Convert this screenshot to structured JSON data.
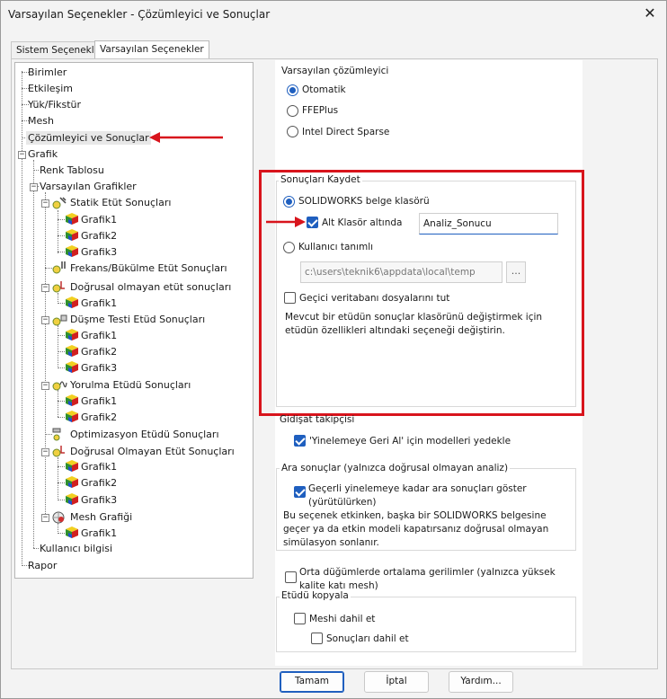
{
  "window": {
    "title": "Varsayılan Seçenekler - Çözümleyici ve Sonuçlar",
    "close_glyph": "✕"
  },
  "tabs": [
    {
      "label": "Sistem Seçenekleri"
    },
    {
      "label": "Varsayılan Seçenekler"
    }
  ],
  "tree": {
    "birimler": "Birimler",
    "etkilesim": "Etkileşim",
    "yuk": "Yük/Fikstür",
    "mesh": "Mesh",
    "cozumleyici": "Çözümleyici ve Sonuçlar",
    "grafik": "Grafik",
    "renk": "Renk Tablosu",
    "varsayilan_grafikler": "Varsayılan Grafikler",
    "statik": "Statik Etüt Sonuçları",
    "frekans": "Frekans/Bükülme Etüt Sonuçları",
    "dogrusal_olmayan": "Doğrusal olmayan etüt sonuçları",
    "dusme": "Düşme Testi Etüd Sonuçları",
    "yorulma": "Yorulma Etüdü Sonuçları",
    "optimizasyon": "Optimizasyon Etüdü Sonuçları",
    "dogrusal_olmayan2": "Doğrusal Olmayan Etüt Sonuçları",
    "mesh_grafigi": "Mesh Grafiği",
    "kullanici": "Kullanıcı bilgisi",
    "rapor": "Rapor",
    "grafik1": "Grafik1",
    "grafik2": "Grafik2",
    "grafik3": "Grafik3"
  },
  "solver": {
    "title": "Varsayılan çözümleyici",
    "options": [
      {
        "label": "Otomatik",
        "selected": true
      },
      {
        "label": "FFEPlus",
        "selected": false
      },
      {
        "label": "Intel Direct Sparse",
        "selected": false
      }
    ]
  },
  "save_results": {
    "title": "Sonuçları Kaydet",
    "solidworks_folder": "SOLIDWORKS belge klasörü",
    "subfolder_label": "Alt Klasör altında",
    "subfolder_value": "Analiz_Sonucu",
    "user_defined": "Kullanıcı tanımlı",
    "user_path": "c:\\users\\teknik6\\appdata\\local\\temp",
    "browse": "...",
    "temp_db": "Geçici veritabanı dosyalarını tut",
    "info": "Mevcut bir etüdün sonuçlar klasörünü değiştirmek için etüdün özellikleri altındaki seçeneği değiştirin."
  },
  "tracker": {
    "title": "Gidişat takipçisi",
    "backup": "'Yinelemeye Geri Al' için modelleri yedekle"
  },
  "intermediate": {
    "title": "Ara sonuçlar (yalnızca doğrusal olmayan analiz)",
    "show": "Geçerli yinelemeye kadar ara sonuçları göster (yürütülürken)",
    "info": "Bu seçenek etkinken, başka bir SOLIDWORKS belgesine geçer ya da etkin modeli kapatırsanız doğrusal olmayan simülasyon sonlanır."
  },
  "averaging": {
    "label": "Orta düğümlerde ortalama gerilimler (yalnızca yüksek kalite katı mesh)"
  },
  "copy_study": {
    "title": "Etüdü kopyala",
    "include_mesh": "Meshi dahil et",
    "include_results": "Sonuçları dahil et"
  },
  "buttons": {
    "ok": "Tamam",
    "cancel": "İptal",
    "help": "Yardım..."
  },
  "colors": {
    "accent": "#1f5fbf",
    "highlight": "#d8141c"
  }
}
